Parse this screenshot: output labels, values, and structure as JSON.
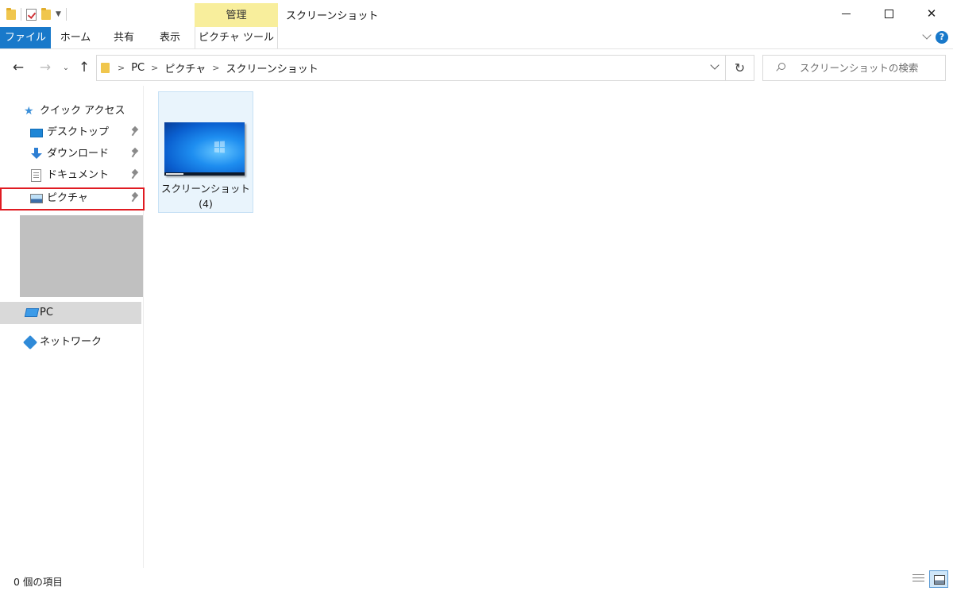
{
  "window": {
    "title": "スクリーンショット",
    "contextual_group": "管理"
  },
  "window_controls": {
    "minimize_icon": "minimize-icon",
    "maximize_icon": "maximize-icon",
    "close_glyph": "✕"
  },
  "ribbon": {
    "tabs": [
      {
        "label": "ファイル",
        "active": true
      },
      {
        "label": "ホーム"
      },
      {
        "label": "共有"
      },
      {
        "label": "表示"
      },
      {
        "label": "ピクチャ ツール"
      }
    ],
    "help_label": "?"
  },
  "navigation": {
    "back": "←",
    "forward": "→",
    "recent": "⌄",
    "up": "↑",
    "refresh": "↻"
  },
  "address": {
    "crumbs": [
      "PC",
      "ピクチャ",
      "スクリーンショット"
    ],
    "separator": ">"
  },
  "search": {
    "placeholder": "スクリーンショットの検索"
  },
  "sidebar": {
    "quick_access": {
      "label": "クイック アクセス",
      "icon": "star-icon"
    },
    "items": [
      {
        "label": "デスクトップ",
        "icon": "desktop-icon",
        "pinned": true
      },
      {
        "label": "ダウンロード",
        "icon": "download-icon",
        "pinned": true
      },
      {
        "label": "ドキュメント",
        "icon": "document-icon",
        "pinned": true
      },
      {
        "label": "ピクチャ",
        "icon": "pictures-icon",
        "pinned": true,
        "highlighted": true
      }
    ],
    "pc": {
      "label": "PC",
      "icon": "pc-icon"
    },
    "network": {
      "label": "ネットワーク",
      "icon": "network-icon"
    }
  },
  "content": {
    "items": [
      {
        "name": "スクリーンショット",
        "count": "(4)"
      }
    ]
  },
  "statusbar": {
    "item_count": "0 個の項目"
  },
  "colors": {
    "file_tab": "#1979ca",
    "contextual_tab": "#f8ee9c",
    "highlight_border": "#e01b22",
    "selected_tile_bg": "#e9f4fc"
  }
}
